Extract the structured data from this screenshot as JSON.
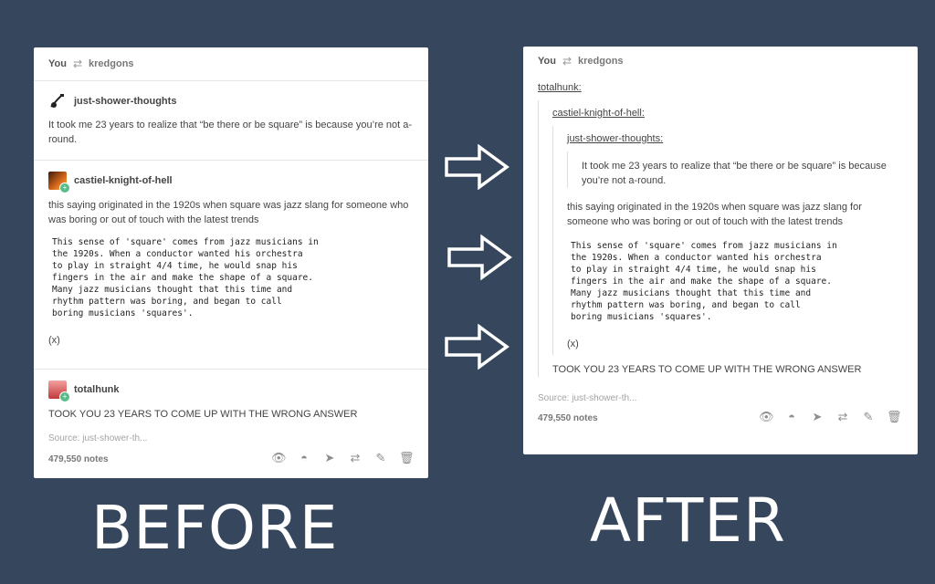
{
  "before": {
    "header": {
      "you": "You",
      "reblog_glyph": "⇄",
      "user": "kredgons"
    },
    "post1": {
      "username": "just-shower-thoughts",
      "text": "It took me 23 years to realize that “be there or be square” is because you’re not a-round."
    },
    "post2": {
      "username": "castiel-knight-of-hell",
      "text": "this saying originated in the 1920s when square was jazz slang for someone who was boring or out of touch with the latest trends",
      "excerpt": "This sense of 'square' comes from jazz musicians in\nthe 1920s. When a conductor wanted his orchestra\nto play in straight 4/4 time, he would snap his\nfingers in the air and make the shape of a square.\nMany jazz musicians thought that this time and\nrhythm pattern was boring, and began to call\nboring musicians 'squares'.",
      "link": "(x)"
    },
    "post3": {
      "username": "totalhunk",
      "text": "TOOK YOU 23 YEARS TO COME UP WITH THE WRONG ANSWER"
    },
    "source": "Source: just-shower-th...",
    "notes": "479,550 notes",
    "label": "BEFORE"
  },
  "after": {
    "header": {
      "you": "You",
      "reblog_glyph": "⇄",
      "user": "kredgons"
    },
    "l1_user": "totalhunk:",
    "l2_user": "castiel-knight-of-hell:",
    "l3_user": "just-shower-thoughts:",
    "l3_text": "It took me 23 years to realize that “be there or be square” is because you’re not a-round.",
    "l2_text": "this saying originated in the 1920s when square was jazz slang for someone who was boring or out of touch with the latest trends",
    "excerpt": "This sense of 'square' comes from jazz musicians in\nthe 1920s. When a conductor wanted his orchestra\nto play in straight 4/4 time, he would snap his\nfingers in the air and make the shape of a square.\nMany jazz musicians thought that this time and\nrhythm pattern was boring, and began to call\nboring musicians 'squares'.",
    "link": "(x)",
    "l1_text": "TOOK YOU 23 YEARS TO COME UP WITH THE WRONG ANSWER",
    "source": "Source: just-shower-th...",
    "notes": "479,550 notes",
    "label": "AFTER"
  },
  "icons": [
    "eye-icon",
    "ghost-icon",
    "share-icon",
    "reblog-icon",
    "edit-icon",
    "trash-icon"
  ],
  "colors": {
    "background": "#36465d",
    "card": "#ffffff",
    "follow_badge": "#56bc8a"
  }
}
